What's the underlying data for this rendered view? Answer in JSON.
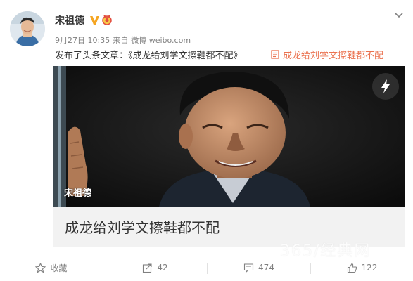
{
  "user": {
    "name": "宋祖德"
  },
  "post": {
    "date": "9月27日 10:35",
    "source_prefix": "来自",
    "source": "微博 weibo.com",
    "text": "发布了头条文章：《成龙给刘学文擦鞋都不配》",
    "article_link": "成龙给刘学文擦鞋都不配"
  },
  "card": {
    "watermark": "宋祖德",
    "title": "成龙给刘学文擦鞋都不配"
  },
  "site_mark": "365/经典网",
  "actions": [
    {
      "label": "收藏"
    },
    {
      "label": "42"
    },
    {
      "label": "474"
    },
    {
      "label": "122"
    }
  ],
  "colors": {
    "link": "#eb7350",
    "verified": "#f5a623",
    "muted": "#808080"
  },
  "icons": [
    "verified-icon",
    "medal-icon",
    "chevron-down-icon",
    "bolt-icon",
    "article-icon",
    "star-icon",
    "share-icon",
    "comment-icon",
    "like-icon"
  ]
}
